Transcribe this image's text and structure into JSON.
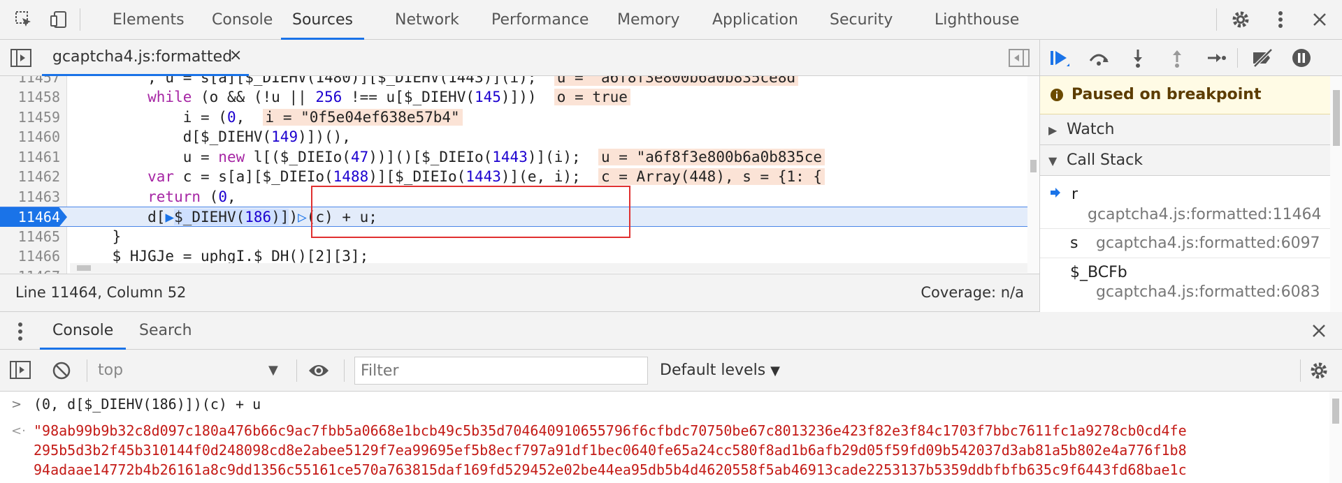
{
  "devtools": {
    "tabs": [
      "Elements",
      "Console",
      "Sources",
      "Network",
      "Performance",
      "Memory",
      "Application",
      "Security",
      "Lighthouse"
    ],
    "active_tab": "Sources",
    "accent_color": "#1a73e8"
  },
  "sources": {
    "open_file": "gcaptcha4.js:formatted",
    "close_glyph": "×",
    "status_position": "Line 11464, Column 52",
    "coverage": "Coverage: n/a",
    "lines": [
      {
        "n": "11457",
        "code": "        , u = s[a][$_DIEHV(1480)][$_DIEHV(1443)](i);",
        "inline": "u = \"a6f8f3e800b6a0b835ce8d"
      },
      {
        "n": "11458",
        "code": "        while (o && (!u || 256 !== u[$_DIEHV(145)]))",
        "inline": "o = true"
      },
      {
        "n": "11459",
        "code": "            i = (0,",
        "inline": "i = \"0f5e04ef638e57b4\""
      },
      {
        "n": "11460",
        "code": "            d[$_DIEHV(149)])(),",
        "inline": ""
      },
      {
        "n": "11461",
        "code": "            u = new l[($_DIEIo(47))]()[$_DIEIo(1443)](i);",
        "inline": "u = \"a6f8f3e800b6a0b835ce"
      },
      {
        "n": "11462",
        "code": "        var c = s[a][$_DIEIo(1488)][$_DIEIo(1443)](e, i);",
        "inline": "c = Array(448), s = {1: {"
      },
      {
        "n": "11463",
        "code": "        return (0,",
        "inline": ""
      },
      {
        "n": "11464",
        "code": "        d[$_DIEHV(186)])(c) + u;",
        "inline": ""
      },
      {
        "n": "11465",
        "code": "    }",
        "inline": ""
      },
      {
        "n": "11466",
        "code": "    $_HJGJe = uphgI.$_DH()[2][3];",
        "inline": ""
      },
      {
        "n": "11467",
        "code": "",
        "inline": ""
      }
    ],
    "current_line": "11464"
  },
  "debugger": {
    "paused_message": "Paused on breakpoint",
    "watch_label": "Watch",
    "callstack_label": "Call Stack",
    "frames": [
      {
        "fn": "r",
        "location": "gcaptcha4.js:formatted:11464"
      },
      {
        "fn": "s",
        "location": "gcaptcha4.js:formatted:6097"
      },
      {
        "fn": "$_BCFb",
        "location": "gcaptcha4.js:formatted:6083"
      }
    ]
  },
  "drawer": {
    "tabs": [
      "Console",
      "Search"
    ],
    "active_tab": "Console",
    "context": "top",
    "filter_placeholder": "Filter",
    "levels": "Default levels",
    "input_expression": "(0, d[$_DIEHV(186)])(c) + u",
    "result_lines": [
      "\"98ab99b9b32c8d097c180a476b66c9ac7fbb5a0668e1bcb49c5b35d704640910655796f6cfbdc70750be67c8013236e423f82e3f84c1703f7bbc7611fc1a9278cb0cd4fe",
      "295b5d3b2f45b310144f0d248098cd8e2abee5129f7ea99695ef5b8ecf797a91df1bec0640fe65a24cc580f8ad1b6afb29d05f59fd09b542037d3ab81a5b802e4a776f1b8",
      "94adaae14772b4b26161a8c9dd1356c55161ce570a763815daf169fd529452e02be44ea95db5b4d4620558f5ab46913cade2253137b5359ddbfbfb635c9f6443fd68bae1c"
    ]
  }
}
